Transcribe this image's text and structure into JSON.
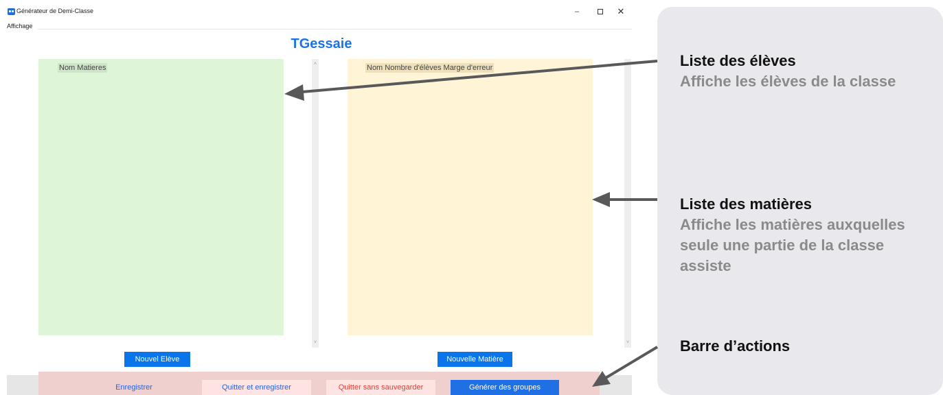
{
  "window": {
    "title": "Générateur de Demi-Classe",
    "menu": "Affichage",
    "minimize": "–",
    "close": "✕"
  },
  "class_title": "TGessaie",
  "lists": {
    "eleves_header": "Nom Matieres",
    "matieres_header": "Nom Nombre d'élèves Marge d'erreur"
  },
  "buttons": {
    "nouvel_eleve": "Nouvel Elève",
    "nouvelle_matiere": "Nouvelle Matière"
  },
  "actions": {
    "enregistrer": "Enregistrer",
    "quitter_enregistrer": "Quitter et enregistrer",
    "quitter_sans": "Quitter sans sauvegarder",
    "generer": "Générer des groupes"
  },
  "callouts": [
    {
      "title": "Liste des élèves",
      "desc": "Affiche les élèves de la classe"
    },
    {
      "title": "Liste des matières",
      "desc": "Affiche les matières auxquelles seule une partie de la classe assiste"
    },
    {
      "title": "Barre d’actions",
      "desc": ""
    }
  ],
  "colors": {
    "accent": "#1a73e8",
    "eleves_bg": "#def5d8",
    "matieres_bg": "#fff5d6",
    "action_bar_bg": "#f0cfcf",
    "danger": "#ee3b2e",
    "arrow": "#595959"
  },
  "icons": {
    "app": "app-icon",
    "scroll_up": "chevron-up-icon",
    "scroll_down": "chevron-down-icon"
  }
}
